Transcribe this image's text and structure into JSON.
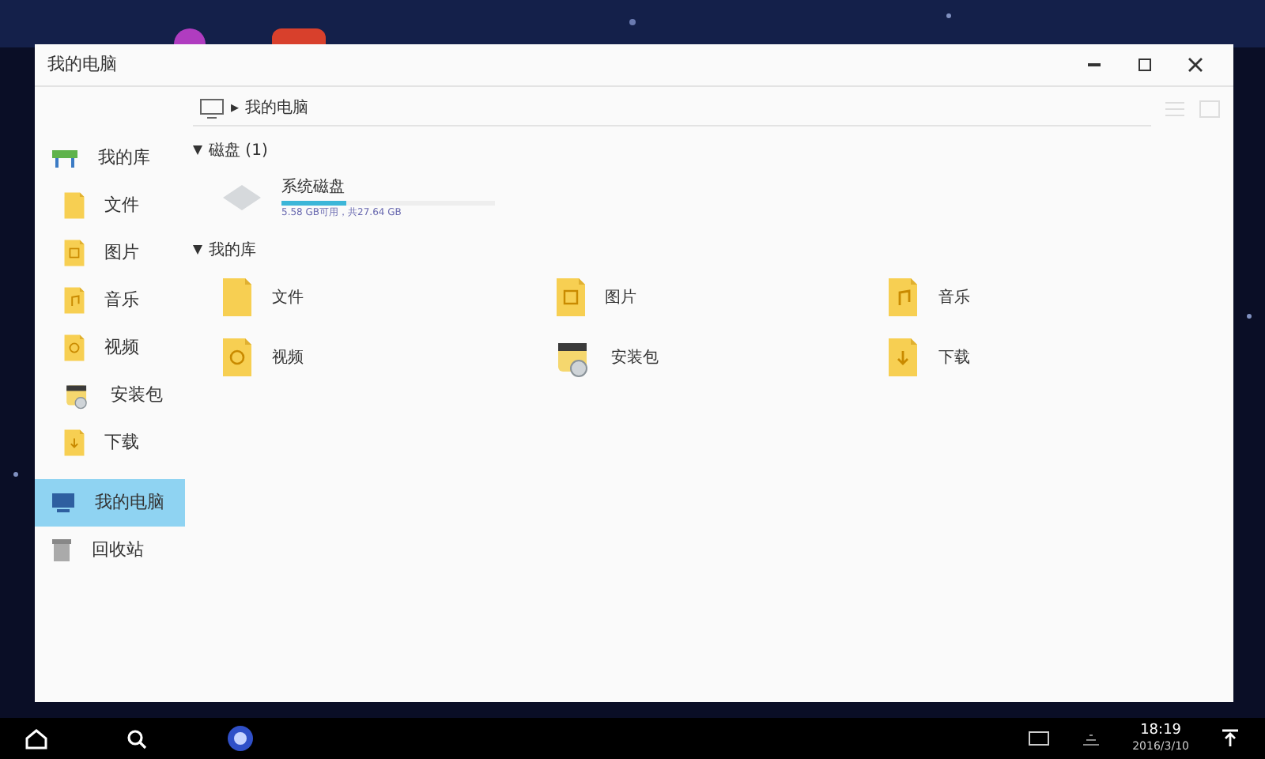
{
  "window": {
    "title": "我的电脑"
  },
  "breadcrumb": {
    "separator": "▸",
    "path": "我的电脑"
  },
  "sidebar": {
    "items": [
      {
        "label": "我的库",
        "kind": "library",
        "selected": false
      },
      {
        "label": "文件",
        "kind": "doc",
        "selected": false
      },
      {
        "label": "图片",
        "selected": false
      },
      {
        "label": "音乐",
        "kind": "music",
        "selected": false
      },
      {
        "label": "视频",
        "kind": "video",
        "selected": false
      },
      {
        "label": "安装包",
        "kind": "package",
        "selected": false
      },
      {
        "label": "下载",
        "kind": "download",
        "selected": false
      },
      {
        "label": "我的电脑",
        "kind": "computer",
        "selected": true
      },
      {
        "label": "回收站",
        "kind": "trash",
        "selected": false
      }
    ]
  },
  "sections": [
    {
      "title": "磁盘 (1)",
      "expanded": true,
      "kind": "disks",
      "disks": [
        {
          "name": "系统磁盘",
          "level": 0.3,
          "info": "5.58 GB可用，共27.64 GB"
        }
      ]
    },
    {
      "title": "我的库",
      "expanded": true,
      "kind": "library",
      "folders": [
        {
          "label": "文件",
          "kind": "doc"
        },
        {
          "label": "图片"
        },
        {
          "label": "音乐",
          "kind": "music"
        },
        {
          "label": "视频",
          "kind": "video"
        },
        {
          "label": "安装包",
          "kind": "package"
        },
        {
          "label": "下载",
          "kind": "download"
        }
      ]
    }
  ],
  "taskbar": {
    "time": "18:19",
    "date": "2016/3/10"
  }
}
